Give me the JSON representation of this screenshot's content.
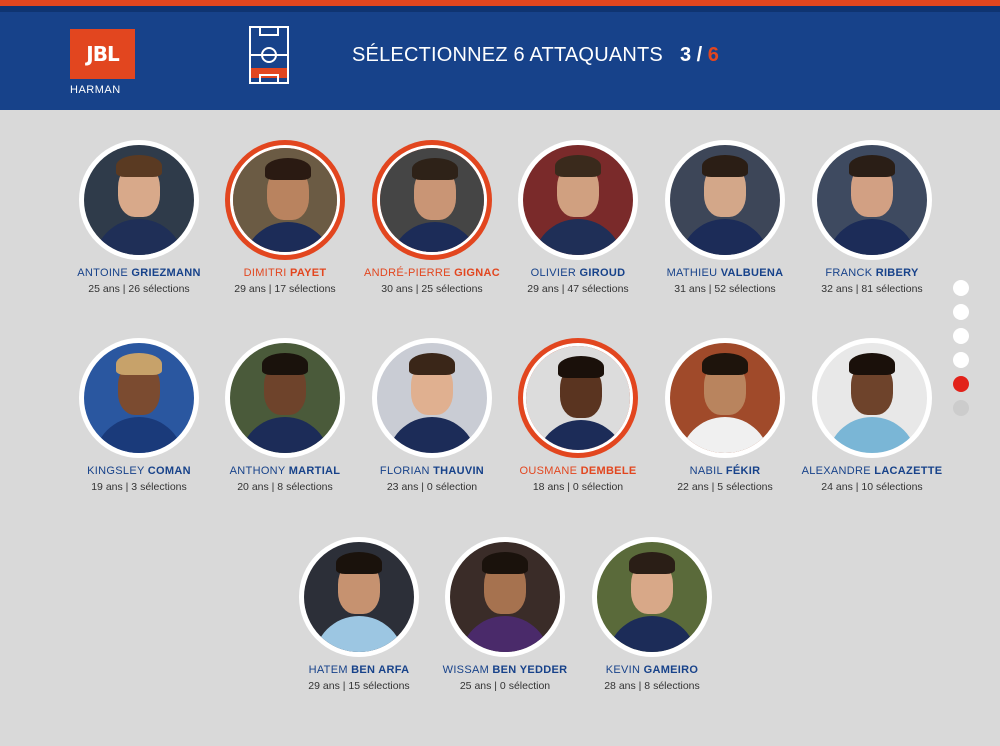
{
  "header": {
    "logo_text": "JBL",
    "logo_sub": "HARMAN",
    "title": "SÉLECTIONNEZ 6 ATTAQUANTS",
    "count_selected": "3",
    "count_separator": " / ",
    "count_total": "6"
  },
  "players": [
    {
      "first": "ANTOINE",
      "last": "GRIEZMANN",
      "meta": "25 ans | 26 sélections",
      "selected": false,
      "skin": "#d8a98a",
      "hair": "#5a3a22",
      "bg": "#2f3b4a",
      "shirt": "#1f2f57"
    },
    {
      "first": "DIMITRI",
      "last": "PAYET",
      "meta": "29 ans | 17 sélections",
      "selected": true,
      "skin": "#b9835f",
      "hair": "#2a1a12",
      "bg": "#6b5b44",
      "shirt": "#1c2c58"
    },
    {
      "first": "ANDRÉ-PIERRE",
      "last": "GIGNAC",
      "meta": "30 ans | 25 sélections",
      "selected": true,
      "skin": "#c99575",
      "hair": "#2e2218",
      "bg": "#454545",
      "shirt": "#1c2c58"
    },
    {
      "first": "OLIVIER",
      "last": "GIROUD",
      "meta": "29 ans | 47 sélections",
      "selected": false,
      "skin": "#d0a080",
      "hair": "#3a2a1c",
      "bg": "#7a2a2a",
      "shirt": "#1f2f57"
    },
    {
      "first": "MATHIEU",
      "last": "VALBUENA",
      "meta": "31 ans | 52 sélections",
      "selected": false,
      "skin": "#d3a789",
      "hair": "#2b1e15",
      "bg": "#3d4658",
      "shirt": "#1c2c58"
    },
    {
      "first": "FRANCK",
      "last": "RIBERY",
      "meta": "32 ans | 81 sélections",
      "selected": false,
      "skin": "#d2a083",
      "hair": "#2a1e16",
      "bg": "#3e4a60",
      "shirt": "#1c2c58"
    },
    {
      "first": "KINGSLEY",
      "last": "COMAN",
      "meta": "19 ans | 3 sélections",
      "selected": false,
      "skin": "#7b4b30",
      "hair": "#c7a26a",
      "bg": "#2a57a0",
      "shirt": "#1a3a7a"
    },
    {
      "first": "ANTHONY",
      "last": "MARTIAL",
      "meta": "20 ans | 8 sélections",
      "selected": false,
      "skin": "#6e432b",
      "hair": "#1a120c",
      "bg": "#4a5a3a",
      "shirt": "#1c2c58"
    },
    {
      "first": "FLORIAN",
      "last": "THAUVIN",
      "meta": "23 ans | 0 sélection",
      "selected": false,
      "skin": "#e0b090",
      "hair": "#3a2618",
      "bg": "#c9ccd4",
      "shirt": "#1c2c58"
    },
    {
      "first": "OUSMANE",
      "last": "DEMBELE",
      "meta": "18 ans | 0 sélection",
      "selected": true,
      "skin": "#5a3420",
      "hair": "#1a100a",
      "bg": "#dcdcdc",
      "shirt": "#1c2c58"
    },
    {
      "first": "NABIL",
      "last": "FÉKIR",
      "meta": "22 ans | 5 sélections",
      "selected": false,
      "skin": "#b9845e",
      "hair": "#1e140c",
      "bg": "#a04a2a",
      "shirt": "#f0f0f0"
    },
    {
      "first": "ALEXANDRE",
      "last": "LACAZETTE",
      "meta": "24 ans | 10 sélections",
      "selected": false,
      "skin": "#6e432b",
      "hair": "#1a100a",
      "bg": "#e8e8e8",
      "shirt": "#7ab6d6"
    },
    {
      "first": "HATEM",
      "last": "BEN ARFA",
      "meta": "29 ans | 15 sélections",
      "selected": false,
      "skin": "#c69270",
      "hair": "#1a120c",
      "bg": "#2c2f38",
      "shirt": "#9cc6e2"
    },
    {
      "first": "WISSAM",
      "last": "BEN YEDDER",
      "meta": "25 ans | 0 sélection",
      "selected": false,
      "skin": "#a6724f",
      "hair": "#1a120c",
      "bg": "#3a2c28",
      "shirt": "#4a2a6a"
    },
    {
      "first": "KEVIN",
      "last": "GAMEIRO",
      "meta": "28 ans | 8 sélections",
      "selected": false,
      "skin": "#d8a888",
      "hair": "#2a1e16",
      "bg": "#5a6a3a",
      "shirt": "#1c2c58"
    }
  ],
  "pagination": {
    "active_index": 4,
    "count": 6
  }
}
